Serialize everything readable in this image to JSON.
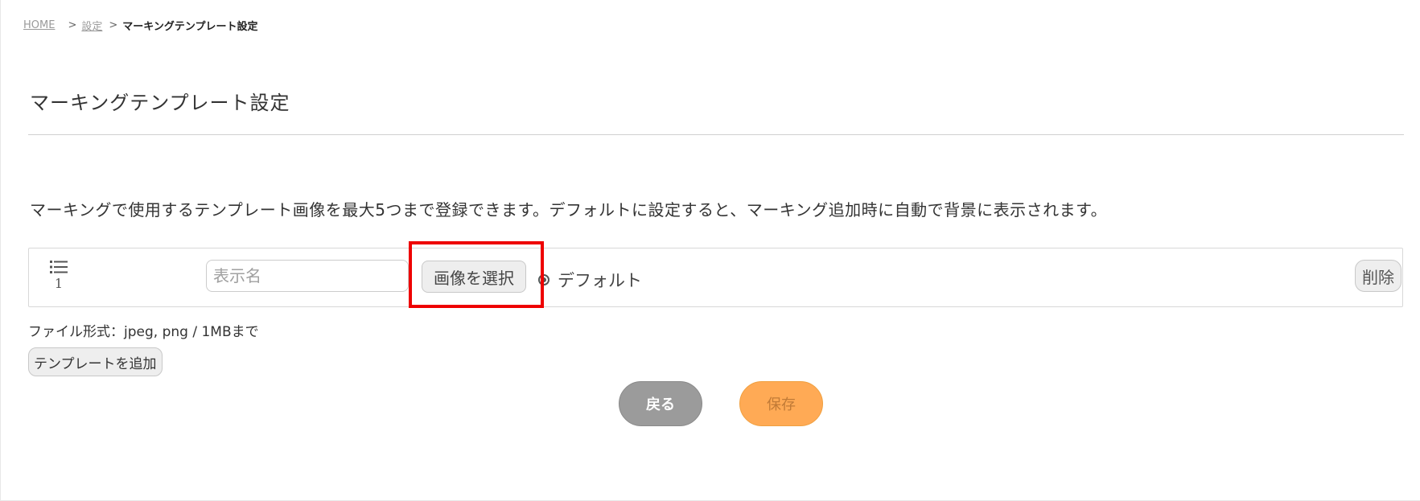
{
  "breadcrumb": {
    "home": "HOME",
    "separator": ">",
    "settings": "設定",
    "current": "マーキングテンプレート設定"
  },
  "page": {
    "title": "マーキングテンプレート設定",
    "description": "マーキングで使用するテンプレート画像を最大5つまで登録できます。デフォルトに設定すると、マーキング追加時に自動で背景に表示されます。"
  },
  "template_row": {
    "index": "1",
    "display_name_placeholder": "表示名",
    "display_name_value": "",
    "select_image_label": "画像を選択",
    "default_label": "デフォルト",
    "default_selected": true,
    "delete_label": "削除"
  },
  "file_format_note": "ファイル形式：jpeg, png / 1MBまで",
  "add_template_label": "テンプレートを追加",
  "actions": {
    "back_label": "戻る",
    "save_label": "保存"
  },
  "colors": {
    "highlight": "#ee0000",
    "save_button": "#ffaa55",
    "back_button": "#9b9b9b"
  }
}
